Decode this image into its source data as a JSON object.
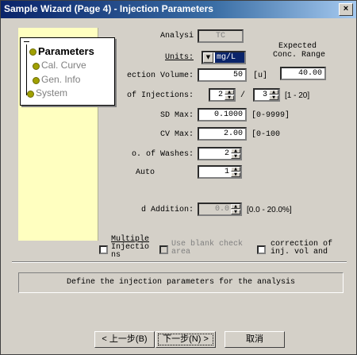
{
  "window": {
    "title": "Sample Wizard (Page 4) - Injection Parameters",
    "close_glyph": "×"
  },
  "nav": {
    "items": [
      {
        "label": "Parameters",
        "active": true
      },
      {
        "label": "Cal. Curve",
        "active": false
      },
      {
        "label": "Gen. Info",
        "active": false
      },
      {
        "label": "System",
        "active": false
      }
    ]
  },
  "form": {
    "analysis": {
      "label": "Analysi",
      "value": "TC"
    },
    "expected": {
      "label_line1": "Expected",
      "label_line2": "Conc. Range",
      "value": "40.00"
    },
    "units": {
      "label": "Units:",
      "value": "mg/L"
    },
    "injection_volume": {
      "label": "ection Volume:",
      "value": "50",
      "unit": "[u]"
    },
    "num_injections": {
      "label": "of Injections:",
      "min_value": "2",
      "separator": "/",
      "max_value": "3",
      "range": "[1 - 20]"
    },
    "sd_max": {
      "label": "SD Max:",
      "value": "0.1000",
      "range": "[0-9999]"
    },
    "cv_max": {
      "label": "CV Max:",
      "value": "2.00",
      "range": "[0-100"
    },
    "num_washes": {
      "label": "o. of Washes:",
      "value": "2"
    },
    "auto": {
      "label": "Auto",
      "value": "1"
    },
    "addition": {
      "label": "d Addition:",
      "value": "0.0",
      "range": "[0.0 - 20.0%]"
    }
  },
  "checkboxes": {
    "multiple": {
      "line1": "Multiple",
      "line2": "Injectio",
      "line3": "ns",
      "checked": false
    },
    "blank": {
      "label": "Use blank check area",
      "checked": false,
      "enabled": false
    },
    "correction": {
      "line1": "correction of",
      "line2": "inj. vol and",
      "checked": false
    }
  },
  "status": {
    "text": "Define the injection parameters for the analysis"
  },
  "buttons": {
    "back": "< 上一步(B)",
    "next": "下一步(N) >",
    "cancel": "取消"
  },
  "colors": {
    "titlebar": "#0a246a",
    "panel": "#ffffc0",
    "dialog": "#d4d0c8"
  },
  "icons": {
    "spinner_up": "▲",
    "spinner_down": "▼",
    "dropdown": "▼"
  }
}
